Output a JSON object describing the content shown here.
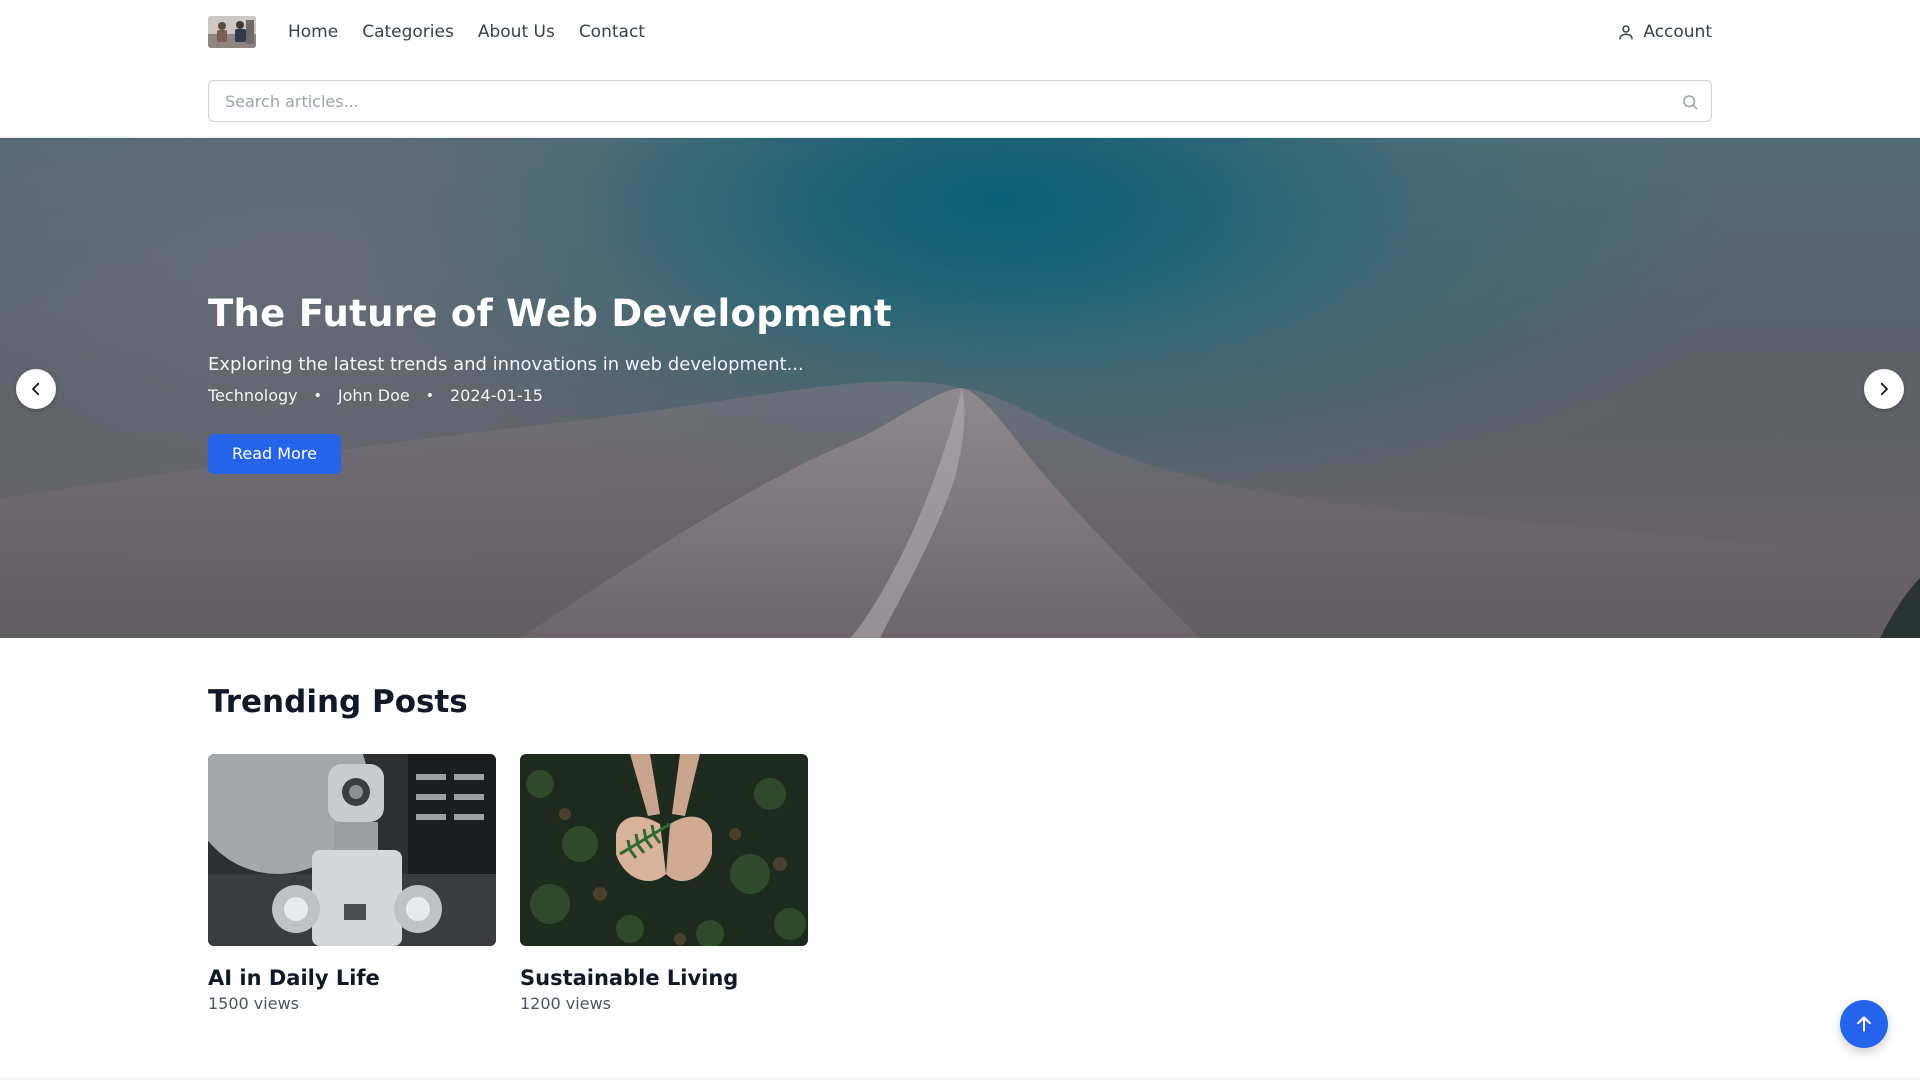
{
  "nav": {
    "logo_icon": "logo-image",
    "links": [
      {
        "label": "Home"
      },
      {
        "label": "Categories"
      },
      {
        "label": "About Us"
      },
      {
        "label": "Contact"
      }
    ],
    "account": {
      "label": "Account",
      "icon": "user-icon"
    }
  },
  "search": {
    "placeholder": "Search articles...",
    "value": "",
    "icon": "search-icon"
  },
  "hero": {
    "title": "The Future of Web Development",
    "subtitle": "Exploring the latest trends and innovations in web development...",
    "category": "Technology",
    "author": "John Doe",
    "date": "2024-01-15",
    "separator": "•",
    "button_label": "Read More",
    "prev_icon": "chevron-left-icon",
    "next_icon": "chevron-right-icon"
  },
  "trending": {
    "title": "Trending Posts",
    "posts": [
      {
        "title": "AI in Daily Life",
        "views": "1500 views",
        "image": "robot-image"
      },
      {
        "title": "Sustainable Living",
        "views": "1200 views",
        "image": "hands-fern-image"
      }
    ]
  },
  "scroll_top": {
    "icon": "arrow-up-icon"
  },
  "colors": {
    "accent": "#2563eb",
    "text": "#111827",
    "muted": "#4b5563"
  }
}
